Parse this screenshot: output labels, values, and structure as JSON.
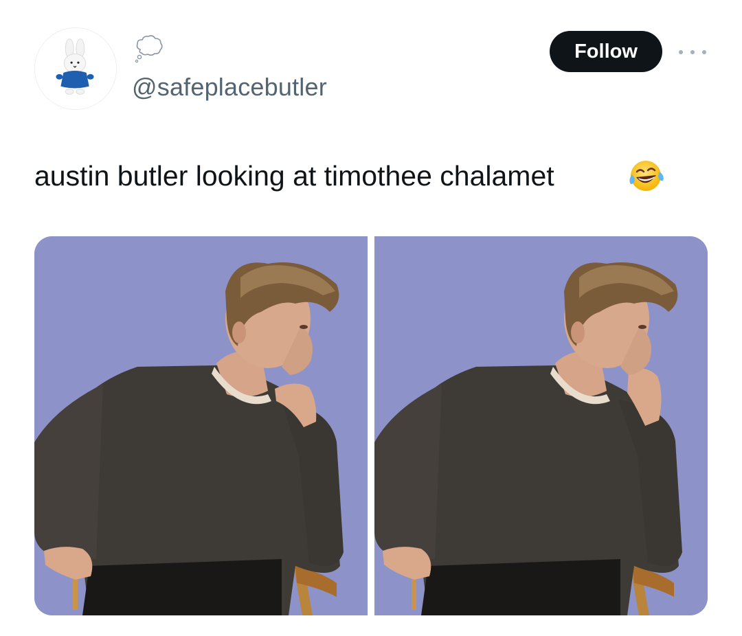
{
  "tweet": {
    "handle": "@safeplacebutler",
    "display_name_icon": "thought-balloon-icon",
    "avatar_icon": "bunny-plush-avatar",
    "follow_label": "Follow",
    "text": "austin butler looking at timothee chalamet",
    "text_emoji": "face-with-tears-of-joy-icon",
    "media": [
      {
        "name": "photo-left",
        "description_icon": "man-on-chair-photo"
      },
      {
        "name": "photo-right",
        "description_icon": "man-on-chair-photo"
      }
    ]
  },
  "colors": {
    "follow_bg": "#0f1419",
    "handle": "#536471",
    "photo_backdrop": "#8a91c6"
  }
}
